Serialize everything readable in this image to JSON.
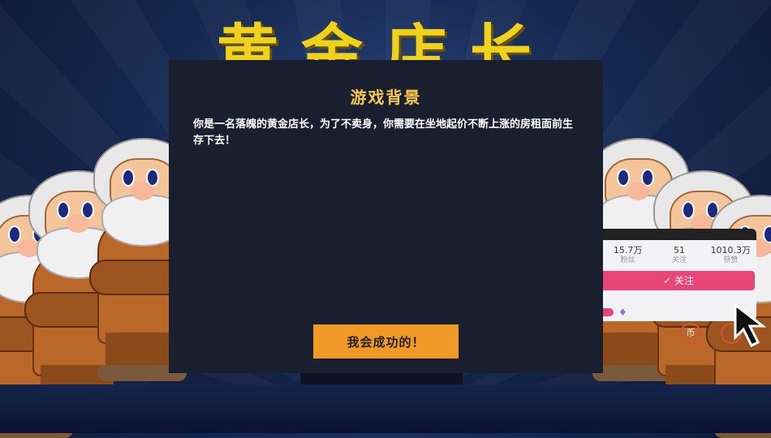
{
  "game": {
    "background_title": "黄金店长"
  },
  "dialog": {
    "title": "游戏背景",
    "text": "你是一名落魄的黄金店长，为了不卖身，你需要在坐地起价不断上涨的房租面前生存下去！",
    "button_label": "我会成功的！"
  },
  "side_panel": {
    "stats": [
      {
        "value": "15.7万",
        "label": "粉丝"
      },
      {
        "value": "51",
        "label": "关注"
      },
      {
        "value": "1010.3万",
        "label": "获赞"
      }
    ],
    "follow_label": "✓ 关注",
    "gem_icon": "diamond-icon",
    "ring_button_1": "币",
    "ring_button_2": "",
    "accent_color": "#e8457a"
  },
  "colors": {
    "dialog_bg": "#1a1f30",
    "title_color": "#f6c84a",
    "button_color": "#ef9a26",
    "bg_title_color": "#f0d21c"
  }
}
